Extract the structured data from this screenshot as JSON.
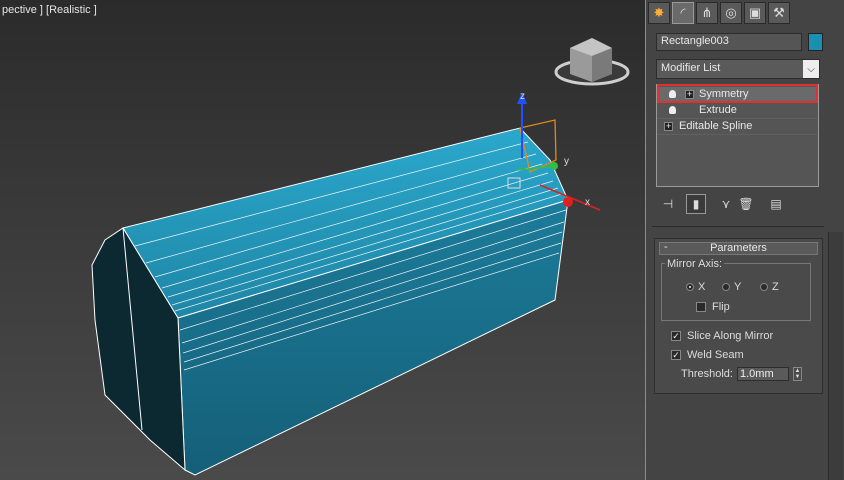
{
  "viewport": {
    "label": "pective ] [Realistic ]",
    "gizmo": {
      "x_label": "x",
      "y_label": "y",
      "z_label": "z"
    },
    "object_color": "#1a8fb0"
  },
  "command_panel": {
    "tabs": [
      {
        "name": "create-tab-icon",
        "glyph": "✸"
      },
      {
        "name": "modify-tab-icon",
        "glyph": "◜"
      },
      {
        "name": "hierarchy-tab-icon",
        "glyph": "⋔"
      },
      {
        "name": "motion-tab-icon",
        "glyph": "◎"
      },
      {
        "name": "display-tab-icon",
        "glyph": "▣"
      },
      {
        "name": "utilities-tab-icon",
        "glyph": "⚒"
      }
    ],
    "object_name": "Rectangle003",
    "object_color": "#1a8fb0",
    "modifier_list_label": "Modifier List",
    "stack": [
      {
        "label": "Symmetry",
        "selected": true
      },
      {
        "label": "Extrude",
        "selected": false
      },
      {
        "label": "Editable Spline",
        "selected": false
      }
    ],
    "highlight_color": "#e03030",
    "rollout": {
      "title": "Parameters",
      "collapse_symbol": "-",
      "mirror_axis_label": "Mirror Axis:",
      "axes": [
        {
          "label": "X",
          "checked": true
        },
        {
          "label": "Y",
          "checked": false
        },
        {
          "label": "Z",
          "checked": false
        }
      ],
      "flip_label": "Flip",
      "flip_checked": false,
      "slice_label": "Slice Along Mirror",
      "slice_checked": true,
      "weld_label": "Weld Seam",
      "weld_checked": true,
      "threshold_label": "Threshold:",
      "threshold_value": "1.0mm"
    }
  }
}
